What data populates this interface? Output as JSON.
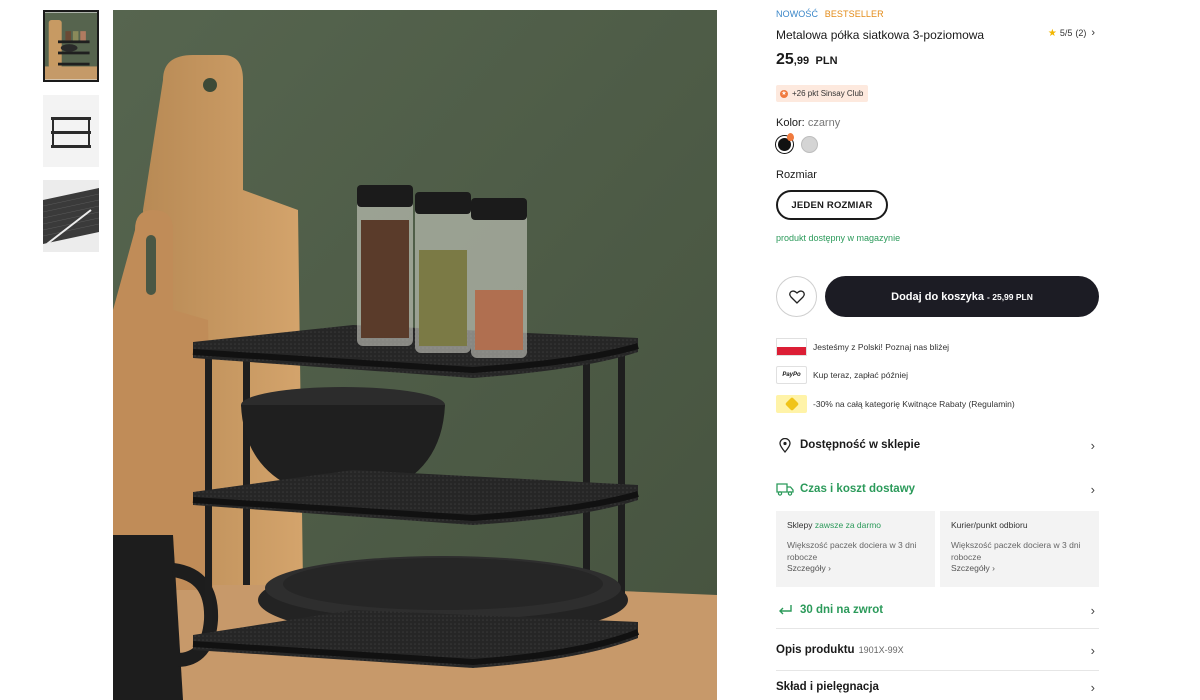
{
  "gallery": {
    "thumbnails": [
      "thumbnail-1",
      "thumbnail-2",
      "thumbnail-3"
    ]
  },
  "product": {
    "badge_new": "NOWOŚĆ",
    "badge_bestseller": "BESTSELLER",
    "title": "Metalowa półka siatkowa 3-poziomowa",
    "rating": "5/5",
    "rating_count": "(2)",
    "price_main": "25",
    "price_cents": ",99",
    "currency": "PLN",
    "club_points": "+26 pkt Sinsay Club",
    "color_label": "Kolor:",
    "color_value": "czarny",
    "size_label": "Rozmiar",
    "size_option": "JEDEN ROZMIAR",
    "availability": "produkt dostępny w magazynie",
    "add_to_cart": "Dodaj do koszyka",
    "add_to_cart_price": "- 25,99 PLN"
  },
  "info_rows": [
    {
      "icon": "poland-flag-icon",
      "text": "Jesteśmy z Polski! Poznaj nas bliżej"
    },
    {
      "icon": "paypal-icon",
      "icon_text": "PayPo",
      "text": "Kup teraz, zapłać później"
    },
    {
      "icon": "promo-tag-icon",
      "text": "-30% na całą kategorię Kwitnące Rabaty (Regulamin)"
    }
  ],
  "accordion": {
    "store_availability": "Dostępność w sklepie",
    "delivery": "Czas i koszt dostawy",
    "returns": "30 dni na zwrot",
    "description": "Opis produktu",
    "description_code": "1901X-99X",
    "composition": "Skład i pielęgnacja"
  },
  "delivery_cards": [
    {
      "title": "Sklepy",
      "highlight": "zawsze za darmo",
      "desc": "Większość paczek dociera w 3 dni robocze",
      "more": "Szczegóły ›"
    },
    {
      "title": "Kurier/punkt odbioru",
      "highlight": "",
      "desc": "Większość paczek dociera w 3 dni robocze",
      "more": "Szczegóły ›"
    }
  ],
  "colors": {
    "accent_green": "#2b9a5a",
    "badge_blue": "#3a86c8",
    "badge_orange": "#e38b18",
    "cart_button": "#1c1c24",
    "wall_green": "#4f5f4a"
  }
}
